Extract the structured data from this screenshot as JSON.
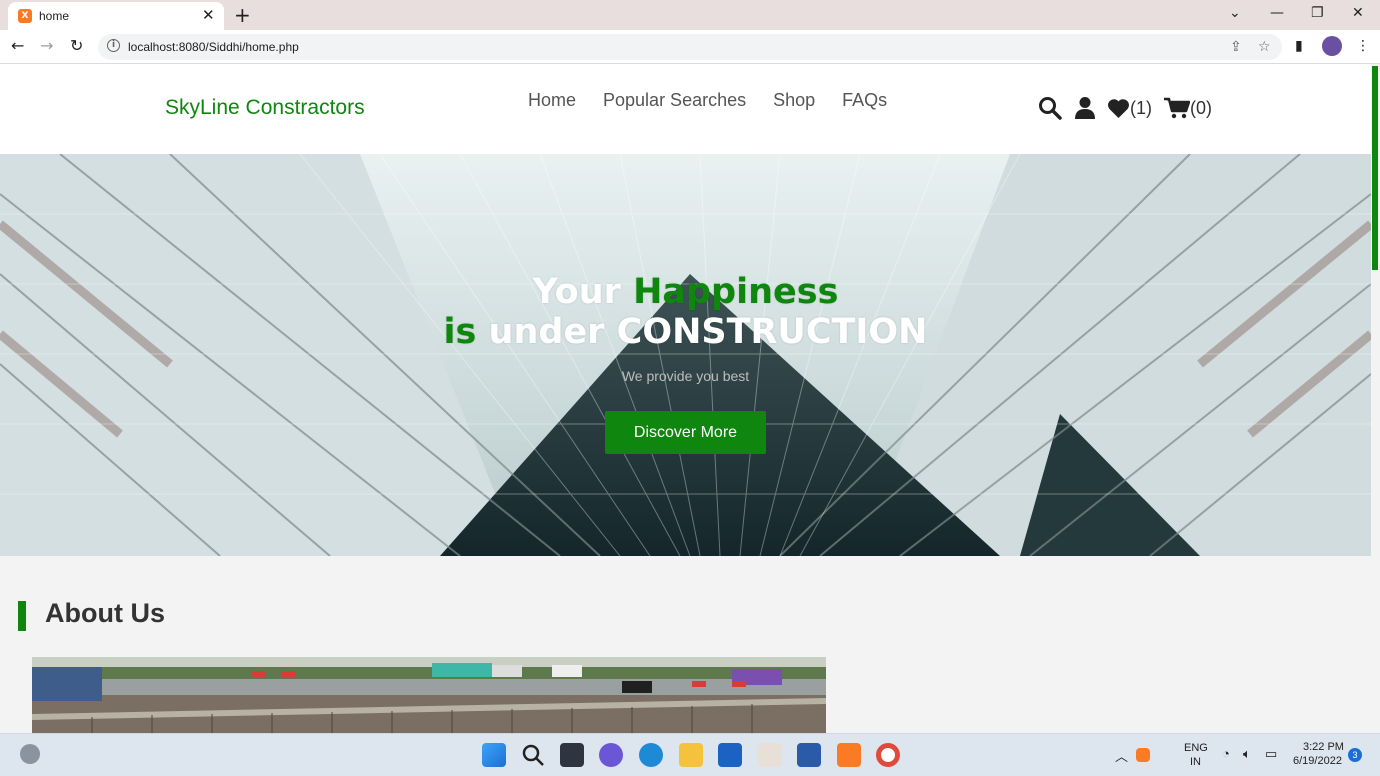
{
  "browser": {
    "tab_title": "home",
    "favicon_text": "X",
    "new_tab_glyph": "+",
    "close_glyph": "✕",
    "url": "localhost:8080/Siddhi/home.php",
    "window_controls": [
      "⌄",
      "—",
      "❐",
      "✕"
    ]
  },
  "site": {
    "logo": "SkyLine Constractors",
    "nav": [
      "Home",
      "Popular Searches",
      "Shop",
      "FAQs"
    ],
    "wishlist_count": "(1)",
    "cart_count": "(0)",
    "accent_color": "#0f870f"
  },
  "hero": {
    "line1_a": "Your ",
    "line1_b": "Happiness",
    "line2_a": "is",
    "line2_b": " under ",
    "line2_c": "CONSTRUCTION",
    "subtitle": "We provide you best",
    "button": "Discover More"
  },
  "about": {
    "heading": "About Us"
  },
  "taskbar": {
    "lang1": "ENG",
    "lang2": "IN",
    "time": "3:22 PM",
    "date": "6/19/2022",
    "notif_count": "3"
  }
}
